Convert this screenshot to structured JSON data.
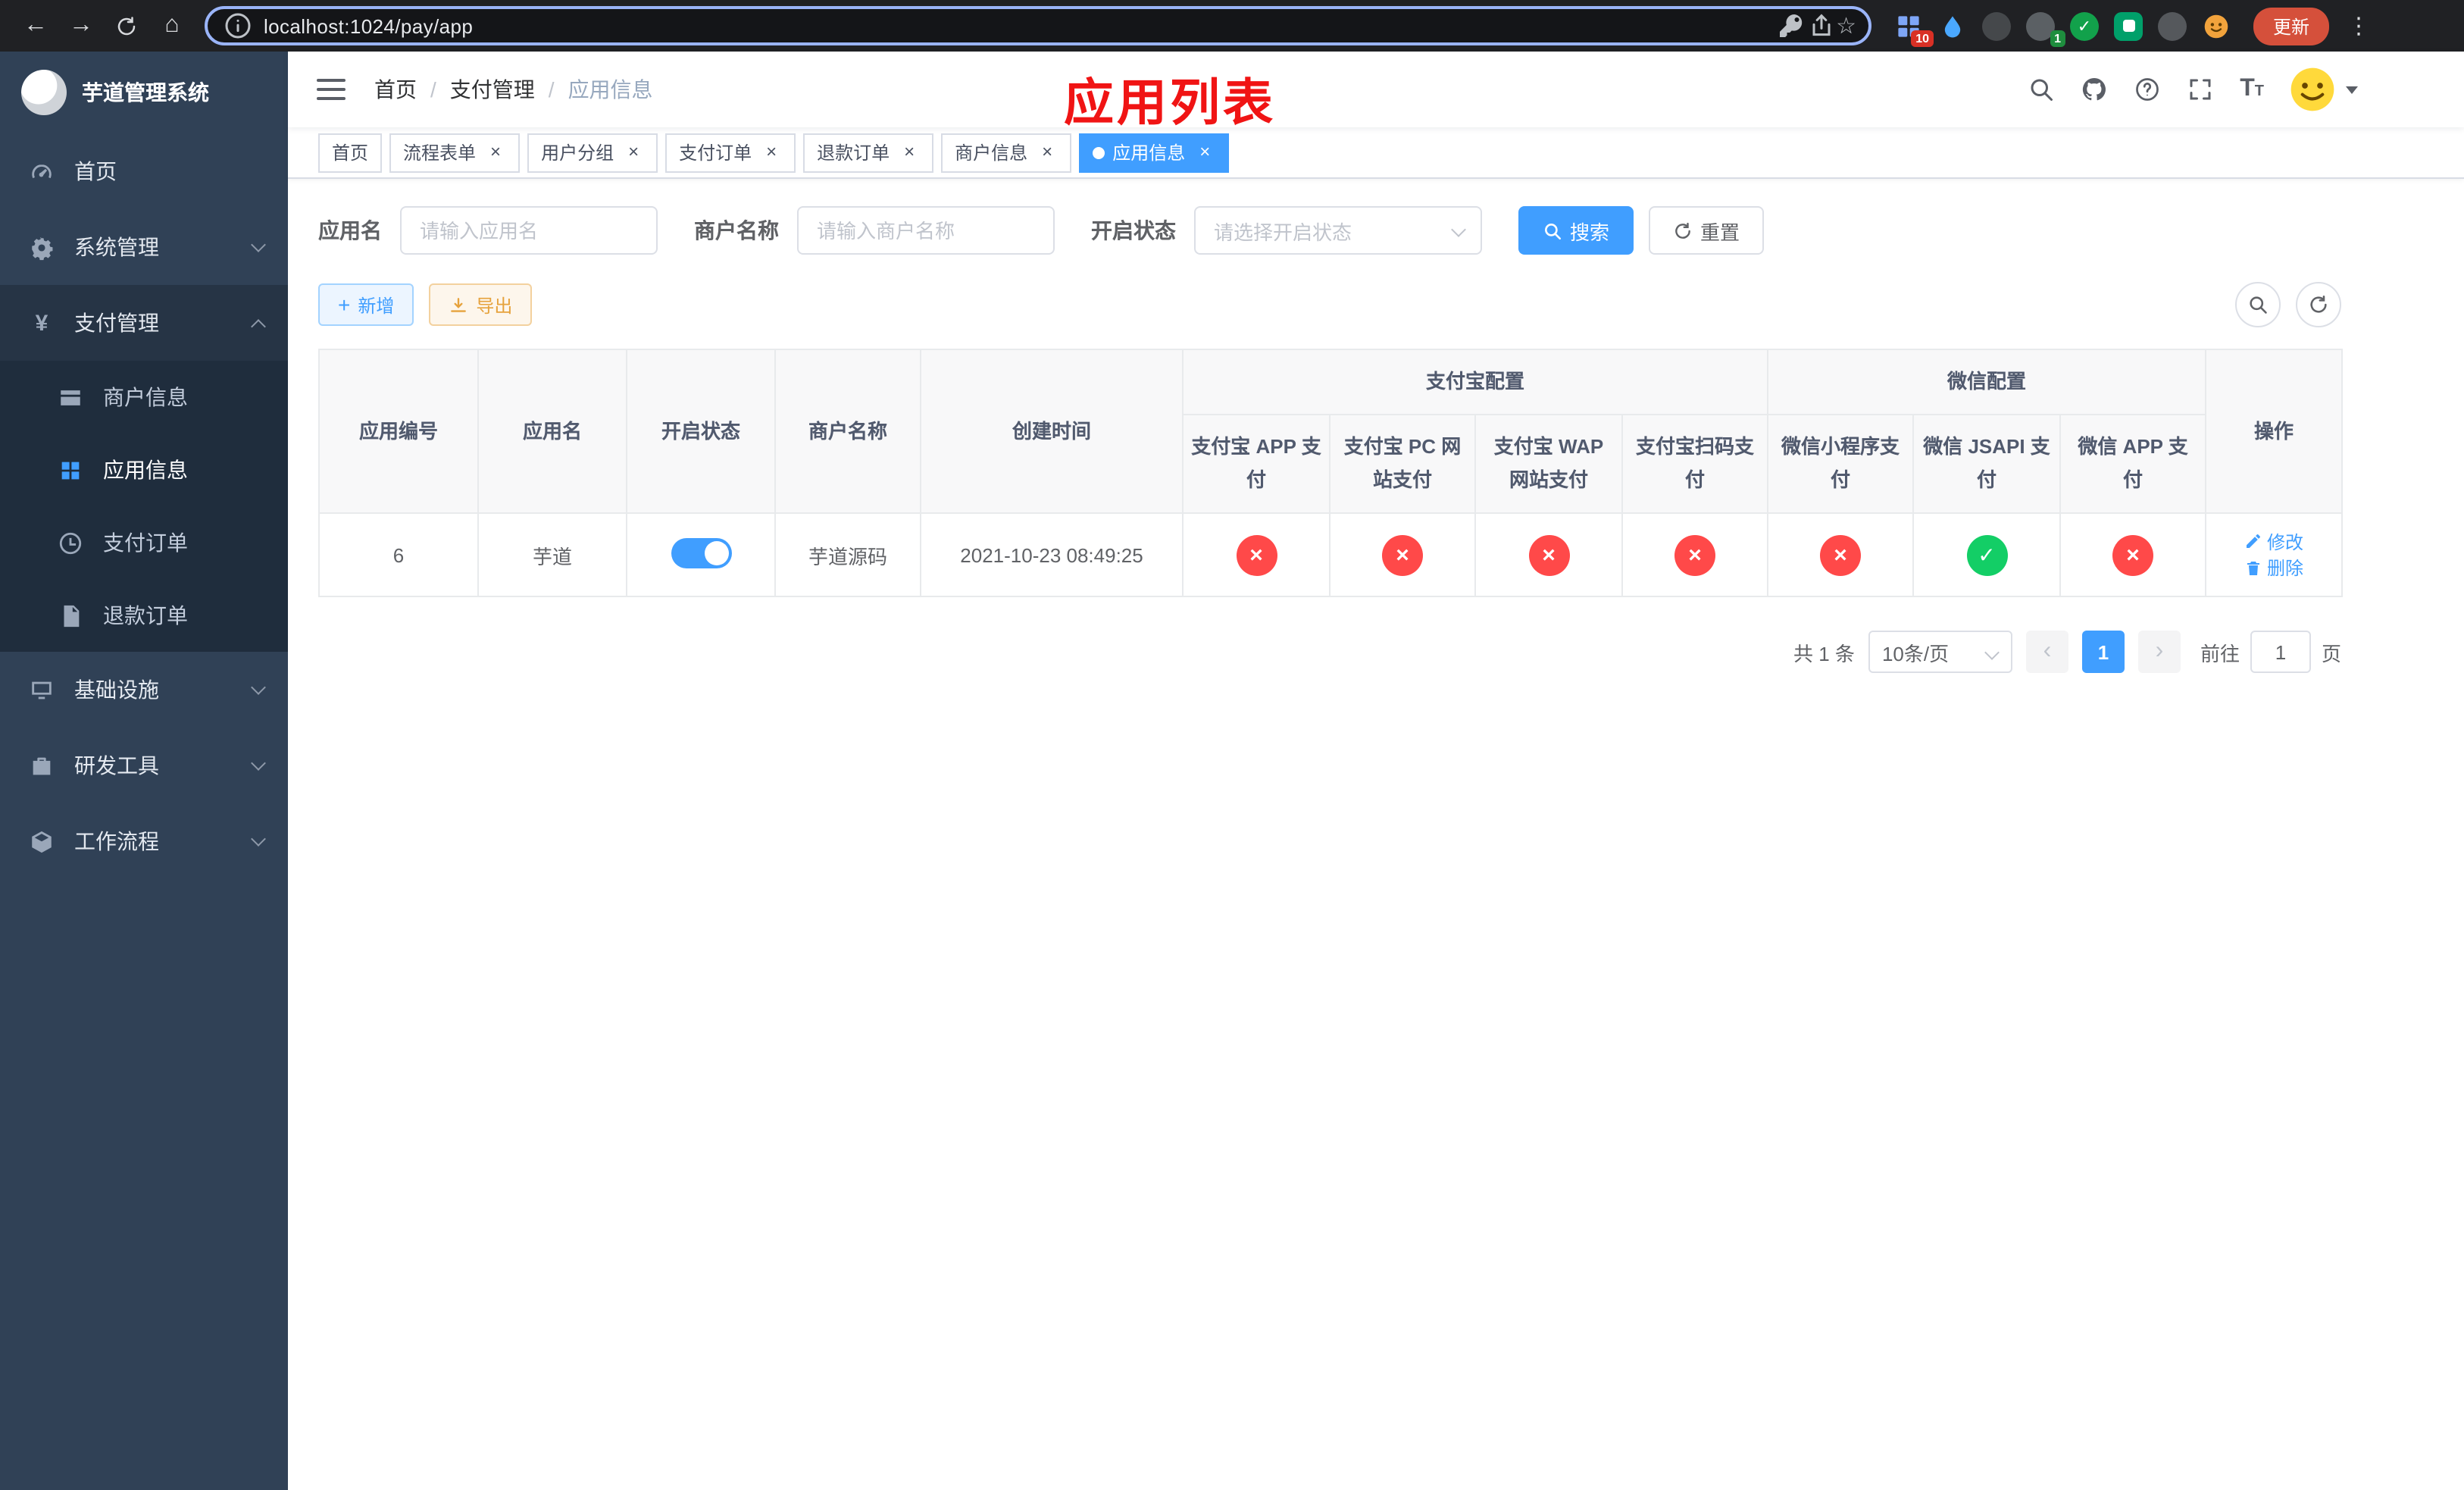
{
  "browser": {
    "url": "localhost:1024/pay/app",
    "update_label": "更新",
    "extension_badge_count": "10",
    "profile_badge_count": "1"
  },
  "sidebar": {
    "logo_title": "芋道管理系统",
    "items": [
      {
        "label": "首页",
        "type": "link"
      },
      {
        "label": "系统管理",
        "type": "submenu",
        "expanded": false
      },
      {
        "label": "支付管理",
        "type": "submenu",
        "expanded": true
      },
      {
        "label": "基础设施",
        "type": "submenu",
        "expanded": false
      },
      {
        "label": "研发工具",
        "type": "submenu",
        "expanded": false
      },
      {
        "label": "工作流程",
        "type": "submenu",
        "expanded": false
      }
    ],
    "pay_children": [
      {
        "label": "商户信息",
        "active": false
      },
      {
        "label": "应用信息",
        "active": true
      },
      {
        "label": "支付订单",
        "active": false
      },
      {
        "label": "退款订单",
        "active": false
      }
    ]
  },
  "header": {
    "breadcrumb": [
      "首页",
      "支付管理",
      "应用信息"
    ],
    "page_title": "应用列表",
    "page_title_color": "#f01414"
  },
  "tabs": [
    {
      "label": "首页",
      "closable": false,
      "active": false
    },
    {
      "label": "流程表单",
      "closable": true,
      "active": false
    },
    {
      "label": "用户分组",
      "closable": true,
      "active": false
    },
    {
      "label": "支付订单",
      "closable": true,
      "active": false
    },
    {
      "label": "退款订单",
      "closable": true,
      "active": false
    },
    {
      "label": "商户信息",
      "closable": true,
      "active": false
    },
    {
      "label": "应用信息",
      "closable": true,
      "active": true
    }
  ],
  "filters": {
    "app_name_label": "应用名",
    "app_name_placeholder": "请输入应用名",
    "merchant_label": "商户名称",
    "merchant_placeholder": "请输入商户名称",
    "status_label": "开启状态",
    "status_placeholder": "请选择开启状态",
    "search_label": "搜索",
    "reset_label": "重置"
  },
  "toolbar": {
    "add_label": "新增",
    "export_label": "导出"
  },
  "table": {
    "headers": {
      "app_id": "应用编号",
      "app_name": "应用名",
      "status": "开启状态",
      "merchant": "商户名称",
      "created": "创建时间",
      "alipay_group": "支付宝配置",
      "wechat_group": "微信配置",
      "alipay_app": "支付宝 APP 支付",
      "alipay_pc": "支付宝 PC 网站支付",
      "alipay_wap": "支付宝 WAP 网站支付",
      "alipay_qr": "支付宝扫码支付",
      "wx_mini": "微信小程序支付",
      "wx_jsapi": "微信 JSAPI 支付",
      "wx_app": "微信 APP 支付",
      "actions": "操作"
    },
    "row": {
      "id": "6",
      "name": "芋道",
      "status_on": true,
      "merchant": "芋道源码",
      "created": "2021-10-23 08:49:25",
      "config_status": {
        "alipay_app": false,
        "alipay_pc": false,
        "alipay_wap": false,
        "alipay_qr": false,
        "wx_mini": false,
        "wx_jsapi": true,
        "wx_app": false
      },
      "edit_label": "修改",
      "delete_label": "删除"
    }
  },
  "pagination": {
    "total_label": "共 1 条",
    "page_size_label": "10条/页",
    "current_page": "1",
    "goto_prefix": "前往",
    "goto_value": "1",
    "goto_suffix": "页"
  },
  "colors": {
    "primary": "#409eff",
    "danger": "#ff4949",
    "success": "#13ce66",
    "sidebar_bg": "#304156",
    "submenu_bg": "#1f2d3d"
  }
}
